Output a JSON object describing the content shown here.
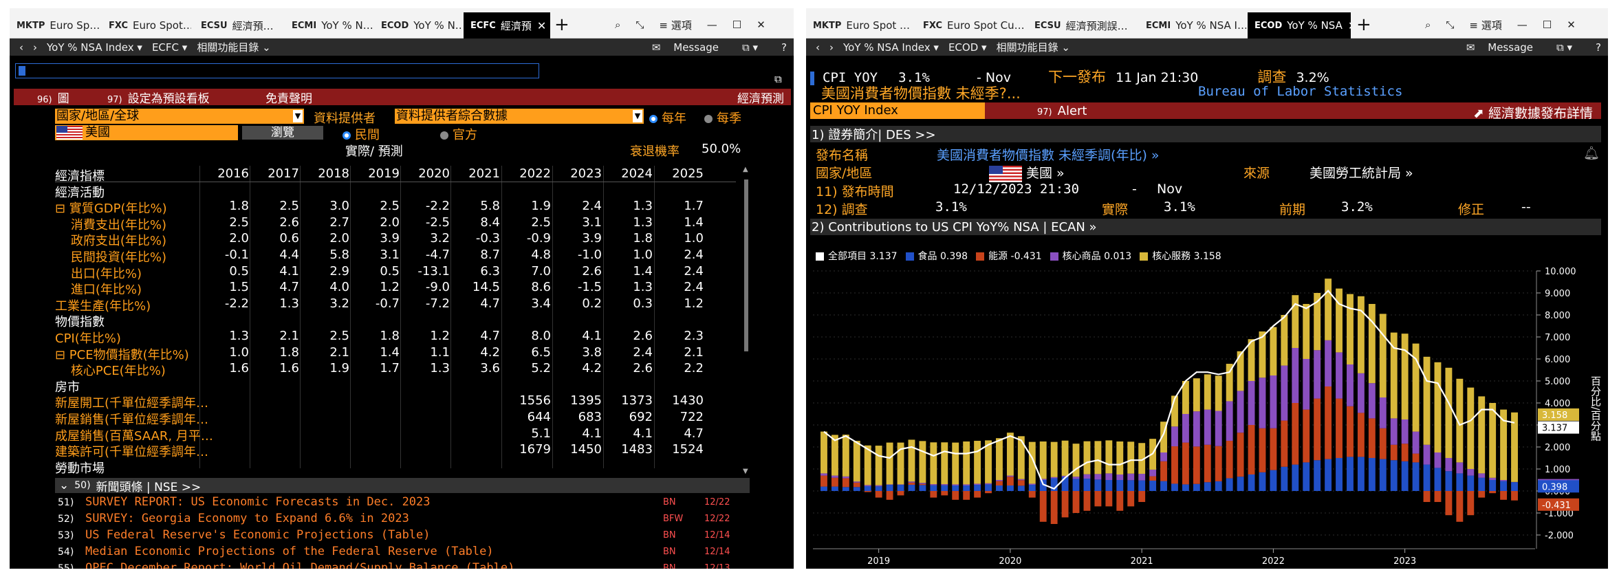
{
  "left": {
    "tabs": [
      {
        "code": "MKTP",
        "label": "Euro Sp…"
      },
      {
        "code": "FXC",
        "label": "Euro Spot…"
      },
      {
        "code": "ECSU",
        "label": "經濟預…"
      },
      {
        "code": "ECMI",
        "label": "YoY % N…"
      },
      {
        "code": "ECOD",
        "label": "YoY % N…"
      },
      {
        "code": "ECFC",
        "label": "經濟預"
      }
    ],
    "window_menu": "選項",
    "nav": {
      "back": "‹",
      "fwd": "›",
      "security": "YoY % NSA Index ▾",
      "func": "ECFC ▾",
      "related": "相關功能目錄 ⌄",
      "message": "Message",
      "help": "?"
    },
    "menu": [
      {
        "num": "96)",
        "label": "圖"
      },
      {
        "num": "97)",
        "label": "設定為預設看板"
      },
      {
        "num": "",
        "label": "免責聲明"
      }
    ],
    "menu_right": "經濟預測",
    "filters": {
      "region": "國家/地區/全球",
      "provider_label": "資料提供者",
      "provider": "資料提供者綜合數據",
      "freq_year": "每年",
      "freq_quarter": "每季",
      "country": "美國",
      "browse": "瀏覽",
      "private": "民間",
      "official": "官方",
      "actual_forecast": "實際/ 預測",
      "recession_label": "衰退機率",
      "recession_value": "50.0%"
    },
    "table": {
      "header": "經濟指標",
      "years": [
        "2016",
        "2017",
        "2018",
        "2019",
        "2020",
        "2021",
        "2022",
        "2023",
        "2024",
        "2025"
      ],
      "rows": [
        {
          "label": "經濟活動",
          "kind": "section",
          "values": []
        },
        {
          "label": "⊟ 實質GDP(年比%)",
          "kind": "item",
          "values": [
            "1.8",
            "2.5",
            "3.0",
            "2.5",
            "-2.2",
            "5.8",
            "1.9",
            "2.4",
            "1.3",
            "1.7"
          ]
        },
        {
          "label": "    消費支出(年比%)",
          "kind": "item",
          "values": [
            "2.5",
            "2.6",
            "2.7",
            "2.0",
            "-2.5",
            "8.4",
            "2.5",
            "3.1",
            "1.3",
            "1.4"
          ]
        },
        {
          "label": "    政府支出(年比%)",
          "kind": "item",
          "values": [
            "2.0",
            "0.6",
            "2.0",
            "3.9",
            "3.2",
            "-0.3",
            "-0.9",
            "3.9",
            "1.8",
            "1.0"
          ]
        },
        {
          "label": "    民間投資(年比%)",
          "kind": "item",
          "values": [
            "-0.1",
            "4.4",
            "5.8",
            "3.1",
            "-4.7",
            "8.7",
            "4.8",
            "-1.0",
            "1.0",
            "2.4"
          ]
        },
        {
          "label": "    出口(年比%)",
          "kind": "item",
          "values": [
            "0.5",
            "4.1",
            "2.9",
            "0.5",
            "-13.1",
            "6.3",
            "7.0",
            "2.6",
            "1.4",
            "2.4"
          ]
        },
        {
          "label": "    進口(年比%)",
          "kind": "item",
          "values": [
            "1.5",
            "4.7",
            "4.0",
            "1.2",
            "-9.0",
            "14.5",
            "8.6",
            "-1.5",
            "1.3",
            "2.4"
          ]
        },
        {
          "label": "工業生產(年比%)",
          "kind": "item",
          "values": [
            "-2.2",
            "1.3",
            "3.2",
            "-0.7",
            "-7.2",
            "4.7",
            "3.4",
            "0.2",
            "0.3",
            "1.2"
          ]
        },
        {
          "label": "物價指數",
          "kind": "section",
          "values": []
        },
        {
          "label": "CPI(年比%)",
          "kind": "item",
          "values": [
            "1.3",
            "2.1",
            "2.5",
            "1.8",
            "1.2",
            "4.7",
            "8.0",
            "4.1",
            "2.6",
            "2.3"
          ]
        },
        {
          "label": "⊟ PCE物價指數(年比%)",
          "kind": "item",
          "values": [
            "1.0",
            "1.8",
            "2.1",
            "1.4",
            "1.1",
            "4.2",
            "6.5",
            "3.8",
            "2.4",
            "2.1"
          ]
        },
        {
          "label": "    核心PCE(年比%)",
          "kind": "item",
          "values": [
            "1.6",
            "1.6",
            "1.9",
            "1.7",
            "1.3",
            "3.6",
            "5.2",
            "4.2",
            "2.6",
            "2.2"
          ]
        },
        {
          "label": "房市",
          "kind": "section",
          "values": []
        },
        {
          "label": "新屋開工(千單位經季調年…",
          "kind": "item",
          "values": [
            "",
            "",
            "",
            "",
            "",
            "",
            "1556",
            "1395",
            "1373",
            "1430"
          ]
        },
        {
          "label": "新屋銷售(千單位經季調年…",
          "kind": "item",
          "values": [
            "",
            "",
            "",
            "",
            "",
            "",
            "644",
            "683",
            "692",
            "722"
          ]
        },
        {
          "label": "成屋銷售(百萬SAAR, 月平…",
          "kind": "item",
          "values": [
            "",
            "",
            "",
            "",
            "",
            "",
            "5.1",
            "4.1",
            "4.1",
            "4.7"
          ]
        },
        {
          "label": "建築許可(千單位經季調年…",
          "kind": "item",
          "values": [
            "",
            "",
            "",
            "",
            "",
            "",
            "1679",
            "1450",
            "1483",
            "1524"
          ]
        },
        {
          "label": "勞動市場",
          "kind": "section",
          "values": []
        }
      ]
    },
    "news": {
      "header_num": "50)",
      "header": "新聞頭條 | NSE >>",
      "items": [
        {
          "num": "51)",
          "title": "SURVEY REPORT: US Economic Forecasts in Dec. 2023",
          "src": "BN",
          "date": "12/22"
        },
        {
          "num": "52)",
          "title": "SURVEY: Georgia Economy to Expand 6.6% in 2023",
          "src": "BFW",
          "date": "12/22"
        },
        {
          "num": "53)",
          "title": "US Federal Reserve's Economic Projections (Table)",
          "src": "BN",
          "date": "12/14"
        },
        {
          "num": "54)",
          "title": "Median Economic Projections of the Federal Reserve (Table)",
          "src": "BN",
          "date": "12/14"
        },
        {
          "num": "55)",
          "title": "OPEC December Report: World Oil Demand/Supply Balance (Table)",
          "src": "BN",
          "date": "12/13"
        }
      ]
    }
  },
  "right": {
    "tabs": [
      {
        "code": "MKTP",
        "label": "Euro Spot …"
      },
      {
        "code": "FXC",
        "label": "Euro Spot Cu…"
      },
      {
        "code": "ECSU",
        "label": "經濟預測誤…"
      },
      {
        "code": "ECMI",
        "label": "YoY % NSA I…"
      },
      {
        "code": "ECOD",
        "label": "YoY % NSA"
      }
    ],
    "window_menu": "選項",
    "nav": {
      "security": "YoY % NSA Index ▾",
      "func": "ECOD ▾",
      "related": "相關功能目錄 ⌄",
      "message": "Message",
      "help": "?"
    },
    "header": {
      "ticker": "CPI YOY",
      "value": "3.1%",
      "period": "- Nov",
      "next_label": "下一發布",
      "next_date": "11 Jan 21:30",
      "survey_label": "調查",
      "survey_value": "3.2%",
      "title_cn": "美國消費者物價指數 未經季?...",
      "source": "Bureau of Labor Statistics"
    },
    "redbar": {
      "index": "CPI YOY Index",
      "alert_num": "97)",
      "alert": "Alert",
      "details": "經濟數據發布詳情"
    },
    "section1": "1) 證券簡介| DES  >>",
    "info": {
      "name_label": "發布名稱",
      "name_value": "美國消費者物價指數 未經季調(年比) »",
      "country_label": "國家/地區",
      "country_value": "美國 »",
      "source_label": "來源",
      "source_value": "美國勞工統計局 »",
      "time_label": "11) 發布時間",
      "time_value": "12/12/2023 21:30",
      "time_dash": "-",
      "time_period": "Nov",
      "survey_label": "12) 調查",
      "survey_value": "3.1%",
      "actual_label": "實際",
      "actual_value": "3.1%",
      "prior_label": "前期",
      "prior_value": "3.2%",
      "revise_label": "修正",
      "revise_value": "--"
    },
    "section2": "2) Contributions to US CPI YoY% NSA | ECAN »"
  },
  "colors": {
    "food": "#2150c8",
    "energy": "#c8431b",
    "core_goods": "#8a4fc0",
    "core_services": "#d8b83a",
    "headline": "#ffffff",
    "orange": "#ff9e1b"
  },
  "chart_data": {
    "type": "bar",
    "stacked": true,
    "ylabel": "百分比/百分點",
    "ylim": [
      -2.5,
      10.0
    ],
    "yticks": [
      "10.000",
      "9.000",
      "8.000",
      "7.000",
      "6.000",
      "5.000",
      "4.000",
      "3.000",
      "2.000",
      "1.000",
      "0.000",
      "-1.000",
      "-2.000"
    ],
    "xticks": [
      "2019",
      "2020",
      "2021",
      "2022",
      "2023"
    ],
    "legend": [
      {
        "name": "全部項目",
        "value": "3.137"
      },
      {
        "name": "食品",
        "value": "0.398"
      },
      {
        "name": "能源",
        "value": "-0.431"
      },
      {
        "name": "核心商品",
        "value": "0.013"
      },
      {
        "name": "核心服務",
        "value": "3.158"
      }
    ],
    "end_labels": [
      "3.158",
      "3.137",
      "0.013",
      "0.398",
      "-0.431"
    ],
    "categories": [
      "2018-08",
      "2018-09",
      "2018-10",
      "2018-11",
      "2018-12",
      "2019-01",
      "2019-02",
      "2019-03",
      "2019-04",
      "2019-05",
      "2019-06",
      "2019-07",
      "2019-08",
      "2019-09",
      "2019-10",
      "2019-11",
      "2019-12",
      "2020-01",
      "2020-02",
      "2020-03",
      "2020-04",
      "2020-05",
      "2020-06",
      "2020-07",
      "2020-08",
      "2020-09",
      "2020-10",
      "2020-11",
      "2020-12",
      "2021-01",
      "2021-02",
      "2021-03",
      "2021-04",
      "2021-05",
      "2021-06",
      "2021-07",
      "2021-08",
      "2021-09",
      "2021-10",
      "2021-11",
      "2021-12",
      "2022-01",
      "2022-02",
      "2022-03",
      "2022-04",
      "2022-05",
      "2022-06",
      "2022-07",
      "2022-08",
      "2022-09",
      "2022-10",
      "2022-11",
      "2022-12",
      "2023-01",
      "2023-02",
      "2023-03",
      "2023-04",
      "2023-05",
      "2023-06",
      "2023-07",
      "2023-08",
      "2023-09",
      "2023-10",
      "2023-11"
    ],
    "series": [
      {
        "name": "食品",
        "values": [
          0.2,
          0.2,
          0.18,
          0.18,
          0.22,
          0.21,
          0.28,
          0.28,
          0.28,
          0.27,
          0.26,
          0.26,
          0.25,
          0.25,
          0.28,
          0.3,
          0.25,
          0.25,
          0.24,
          0.28,
          0.5,
          0.58,
          0.64,
          0.55,
          0.56,
          0.52,
          0.5,
          0.5,
          0.49,
          0.48,
          0.47,
          0.45,
          0.33,
          0.3,
          0.32,
          0.4,
          0.44,
          0.58,
          0.65,
          0.75,
          0.85,
          0.95,
          1.1,
          1.2,
          1.3,
          1.4,
          1.45,
          1.5,
          1.55,
          1.55,
          1.5,
          1.45,
          1.4,
          1.35,
          1.3,
          1.2,
          1.05,
          0.9,
          0.8,
          0.7,
          0.6,
          0.5,
          0.45,
          0.4
        ]
      },
      {
        "name": "能源",
        "values": [
          0.5,
          0.4,
          0.4,
          0.2,
          -0.05,
          -0.3,
          -0.4,
          -0.2,
          0.1,
          0.05,
          -0.3,
          -0.2,
          -0.4,
          -0.4,
          -0.3,
          -0.1,
          0.2,
          0.4,
          0.25,
          -0.3,
          -1.4,
          -1.5,
          -1.2,
          -1.0,
          -0.9,
          -0.7,
          -0.7,
          -0.9,
          -0.7,
          -0.5,
          0.2,
          0.9,
          1.7,
          1.9,
          1.7,
          1.7,
          1.6,
          1.7,
          2.0,
          2.25,
          2.0,
          1.9,
          2.1,
          2.8,
          2.4,
          2.8,
          3.3,
          2.7,
          2.3,
          2.0,
          1.8,
          1.4,
          0.7,
          0.8,
          0.4,
          -0.5,
          -0.5,
          -1.1,
          -1.4,
          -1.1,
          -0.3,
          -0.1,
          -0.4,
          -0.43
        ]
      },
      {
        "name": "核心商品",
        "values": [
          0.1,
          0.1,
          0.08,
          0.05,
          0.05,
          0.05,
          0.02,
          0.02,
          0.05,
          0.05,
          0.05,
          0.05,
          0.05,
          0.05,
          0.05,
          0.05,
          0.05,
          0.05,
          0.05,
          0.05,
          0.05,
          0.05,
          0.05,
          0.1,
          0.2,
          0.25,
          0.3,
          0.25,
          0.3,
          0.3,
          0.3,
          0.4,
          0.9,
          1.3,
          1.6,
          1.6,
          1.6,
          1.8,
          1.9,
          2.0,
          2.3,
          2.4,
          2.5,
          2.5,
          2.3,
          2.2,
          2.1,
          2.1,
          1.9,
          1.8,
          1.6,
          1.4,
          1.2,
          1.1,
          1.0,
          0.9,
          0.7,
          0.6,
          0.5,
          0.3,
          0.2,
          0.1,
          0.05,
          0.01
        ]
      },
      {
        "name": "核心服務",
        "values": [
          1.9,
          1.85,
          1.9,
          1.85,
          1.8,
          1.8,
          1.9,
          1.9,
          1.9,
          1.9,
          1.9,
          1.9,
          1.9,
          1.95,
          1.95,
          1.95,
          1.9,
          1.95,
          1.95,
          1.9,
          1.7,
          1.6,
          1.6,
          1.5,
          1.5,
          1.5,
          1.5,
          1.5,
          1.45,
          1.4,
          1.4,
          1.4,
          1.4,
          1.5,
          1.5,
          1.6,
          1.6,
          1.7,
          1.8,
          1.9,
          2.1,
          2.2,
          2.3,
          2.4,
          2.5,
          2.6,
          2.8,
          2.9,
          3.2,
          3.5,
          3.6,
          3.8,
          3.9,
          3.9,
          4.0,
          4.0,
          4.1,
          4.1,
          3.8,
          3.7,
          3.5,
          3.4,
          3.2,
          3.16
        ]
      }
    ],
    "headline": [
      2.7,
      2.3,
      2.5,
      2.2,
      1.9,
      1.6,
      1.5,
      1.9,
      2.0,
      1.8,
      1.6,
      1.8,
      1.7,
      1.7,
      1.8,
      2.1,
      2.3,
      2.5,
      2.3,
      1.5,
      0.3,
      0.1,
      0.6,
      1.0,
      1.3,
      1.4,
      1.2,
      1.2,
      1.4,
      1.4,
      1.7,
      2.6,
      4.2,
      5.0,
      5.4,
      5.4,
      5.3,
      5.4,
      6.2,
      6.8,
      7.0,
      7.5,
      7.9,
      8.5,
      8.3,
      8.6,
      9.1,
      8.5,
      8.3,
      8.2,
      7.7,
      7.1,
      6.5,
      6.4,
      6.0,
      5.0,
      4.9,
      4.0,
      3.0,
      3.2,
      3.7,
      3.7,
      3.2,
      3.1
    ]
  }
}
